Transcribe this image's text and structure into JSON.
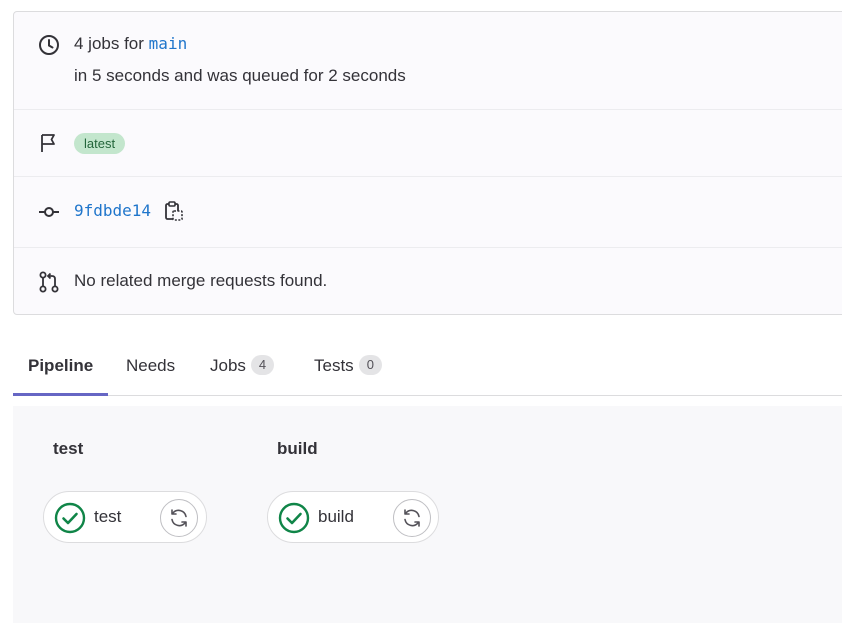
{
  "summary": {
    "jobs_prefix": "4 jobs for",
    "branch": "main",
    "duration_text": "in 5 seconds and was queued for 2 seconds",
    "badge": "latest",
    "commit_sha": "9fdbde14",
    "merge_requests_text": "No related merge requests found."
  },
  "tabs": [
    {
      "label": "Pipeline",
      "active": true
    },
    {
      "label": "Needs"
    },
    {
      "label": "Jobs",
      "count": "4"
    },
    {
      "label": "Tests",
      "count": "0"
    }
  ],
  "stages": [
    {
      "title": "test",
      "job": "test",
      "status": "success"
    },
    {
      "title": "build",
      "job": "build",
      "status": "success"
    }
  ],
  "colors": {
    "link": "#1f75cb",
    "success": "#108548",
    "badge_bg": "#c3e6cd",
    "active_tab": "#6666c4"
  },
  "icons": {
    "duration": "clock-icon",
    "tag": "flag-icon",
    "commit": "commit-icon",
    "merge_request": "merge-request-icon",
    "copy": "copy-to-clipboard-icon",
    "status": "status-success-icon",
    "retry": "retry-icon"
  }
}
